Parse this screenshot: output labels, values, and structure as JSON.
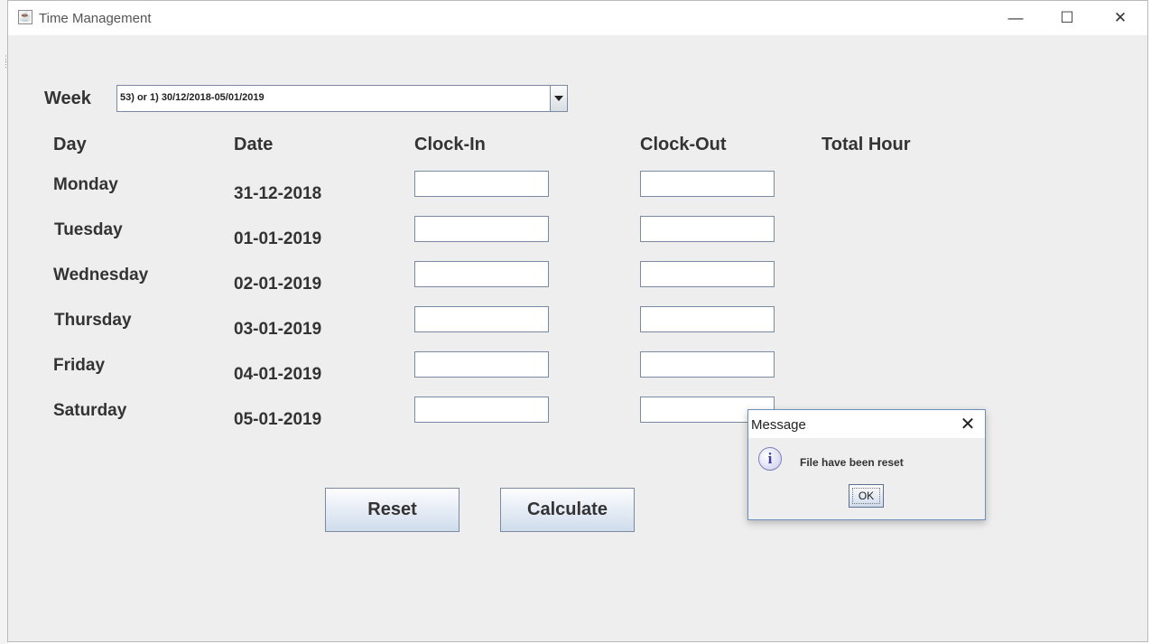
{
  "window": {
    "title": "Time Management",
    "controls": {
      "minimize": "—",
      "maximize": "☐",
      "close": "✕"
    }
  },
  "week": {
    "label": "Week",
    "selected": "53) or 1) 30/12/2018-05/01/2019"
  },
  "table": {
    "headers": {
      "day": "Day",
      "date": "Date",
      "clock_in": "Clock-In",
      "clock_out": "Clock-Out",
      "total_hour": "Total Hour"
    },
    "rows": [
      {
        "day": "Monday",
        "date": "31-12-2018",
        "clock_in": "",
        "clock_out": ""
      },
      {
        "day": "Tuesday",
        "date": "01-01-2019",
        "clock_in": "",
        "clock_out": ""
      },
      {
        "day": "Wednesday",
        "date": "02-01-2019",
        "clock_in": "",
        "clock_out": ""
      },
      {
        "day": "Thursday",
        "date": "03-01-2019",
        "clock_in": "",
        "clock_out": ""
      },
      {
        "day": "Friday",
        "date": "04-01-2019",
        "clock_in": "",
        "clock_out": ""
      },
      {
        "day": "Saturday",
        "date": "05-01-2019",
        "clock_in": "",
        "clock_out": ""
      }
    ]
  },
  "buttons": {
    "reset": "Reset",
    "calculate": "Calculate"
  },
  "dialog": {
    "title": "Message",
    "close": "✕",
    "icon": "info-icon",
    "icon_glyph": "i",
    "message": "File have been reset",
    "ok": "OK"
  }
}
